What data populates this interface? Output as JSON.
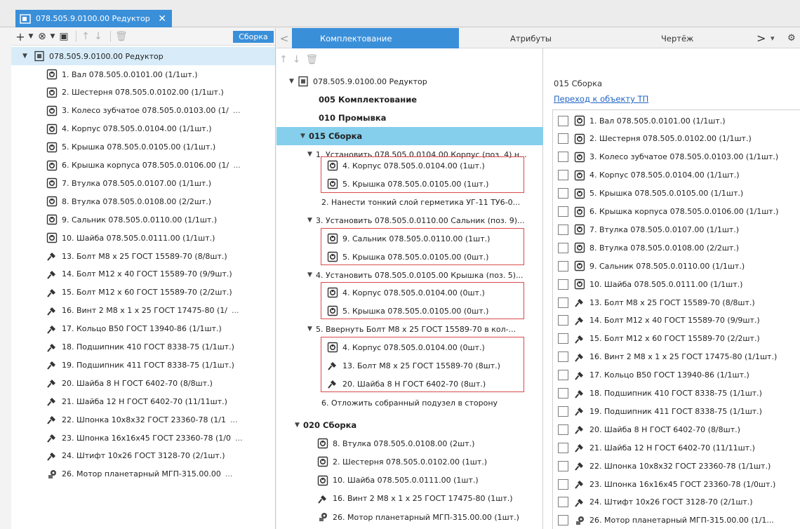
{
  "document_tab": {
    "title": "078.505.9.0100.00 Редуктор",
    "close": "✕"
  },
  "left_panel": {
    "sborka_label": "Сборка",
    "root": "078.505.9.0100.00 Редуктор",
    "items": [
      {
        "label": "1. Вал 078.505.0.0101.00 (1/1шт.)",
        "icon": "part-icon",
        "more": ""
      },
      {
        "label": "2. Шестерня 078.505.0.0102.00 (1/1шт.)",
        "icon": "part-icon",
        "more": ""
      },
      {
        "label": "3. Колесо зубчатое 078.505.0.0103.00 (1/",
        "icon": "part-icon",
        "more": "..."
      },
      {
        "label": "4. Корпус 078.505.0.0104.00 (1/1шт.)",
        "icon": "part-icon",
        "more": ""
      },
      {
        "label": "5. Крышка 078.505.0.0105.00 (1/1шт.)",
        "icon": "part-icon",
        "more": ""
      },
      {
        "label": "6. Крышка корпуса 078.505.0.0106.00 (1/",
        "icon": "part-icon",
        "more": "..."
      },
      {
        "label": "7. Втулка 078.505.0.0107.00 (1/1шт.)",
        "icon": "part-icon",
        "more": ""
      },
      {
        "label": "8. Втулка 078.505.0.0108.00 (2/2шт.)",
        "icon": "part-icon",
        "more": ""
      },
      {
        "label": "9. Сальник 078.505.0.0110.00 (1/1шт.)",
        "icon": "part-icon",
        "more": ""
      },
      {
        "label": "10. Шайба 078.505.0.0111.00 (1/1шт.)",
        "icon": "part-icon",
        "more": ""
      },
      {
        "label": "13. Болт М8 х 25 ГОСТ 15589-70 (8/8шт.)",
        "icon": "bolt-icon",
        "more": ""
      },
      {
        "label": "14. Болт М12 х 40 ГОСТ 15589-70 (9/9шт.)",
        "icon": "bolt-icon",
        "more": ""
      },
      {
        "label": "15. Болт М12 х 60 ГОСТ 15589-70 (2/2шт.)",
        "icon": "bolt-icon",
        "more": ""
      },
      {
        "label": "16. Винт 2 М8 х 1 х 25 ГОСТ 17475-80 (1/",
        "icon": "bolt-icon",
        "more": "..."
      },
      {
        "label": "17. Кольцо В50 ГОСТ 13940-86 (1/1шт.)",
        "icon": "bolt-icon",
        "more": ""
      },
      {
        "label": "18. Подшипник 410 ГОСТ 8338-75 (1/1шт.)",
        "icon": "bolt-icon",
        "more": ""
      },
      {
        "label": "19. Подшипник 411 ГОСТ 8338-75 (1/1шт.)",
        "icon": "bolt-icon",
        "more": ""
      },
      {
        "label": "20. Шайба 8 Н ГОСТ 6402-70 (8/8шт.)",
        "icon": "bolt-icon",
        "more": ""
      },
      {
        "label": "21. Шайба 12 Н ГОСТ 6402-70 (11/11шт.)",
        "icon": "bolt-icon",
        "more": ""
      },
      {
        "label": "22. Шпонка 10х8х32 ГОСТ 23360-78 (1/1",
        "icon": "bolt-icon",
        "more": "..."
      },
      {
        "label": "23. Шпонка 16х16х45 ГОСТ 23360-78 (1/0",
        "icon": "bolt-icon",
        "more": "..."
      },
      {
        "label": "24. Штифт 10х26 ГОСТ 3128-70 (2/1шт.)",
        "icon": "bolt-icon",
        "more": ""
      },
      {
        "label": "26. Мотор планетарный МГП-315.00.00",
        "icon": "motor-icon",
        "more": "..."
      }
    ]
  },
  "tabs": {
    "active": "Комплектование",
    "attributes": "Атрибуты",
    "drawing": "Чертёж",
    "next": ">",
    "menu": "▾",
    "gear": "⚙"
  },
  "middle_tree": {
    "root": "078.505.9.0100.00 Редуктор",
    "op005": "005 Комплектование",
    "op010": "010 Промывка",
    "op015": "015 Сборка",
    "step1": "1. Установить 078.505.0.0104.00 Корпус (поз. 4) н...",
    "step1_items": [
      "4. Корпус 078.505.0.0104.00 (1шт.)",
      "5. Крышка 078.505.0.0105.00 (1шт.)"
    ],
    "step2": "2. Нанести тонкий слой герметика УГ-11 ТУ6-0...",
    "step3": "3. Установить 078.505.0.0110.00 Сальник (поз. 9)...",
    "step3_items": [
      "9. Сальник 078.505.0.0110.00 (1шт.)",
      "5. Крышка 078.505.0.0105.00 (0шт.)"
    ],
    "step4": "4. Установить 078.505.0.0105.00 Крышка (поз. 5)...",
    "step4_items": [
      "4. Корпус 078.505.0.0104.00 (0шт.)",
      "5. Крышка 078.505.0.0105.00 (0шт.)"
    ],
    "step5": "5. Ввернуть  Болт М8 х 25 ГОСТ 15589-70 в кол-...",
    "step5_items": [
      "4. Корпус 078.505.0.0104.00 (0шт.)",
      "13. Болт М8 х 25 ГОСТ 15589-70 (8шт.)",
      "20. Шайба 8 Н ГОСТ 6402-70 (8шт.)"
    ],
    "step6": "6. Отложить собранный подузел в сторону",
    "op020": "020 Сборка",
    "op020_items": [
      "8. Втулка 078.505.0.0108.00 (2шт.)",
      "2. Шестерня 078.505.0.0102.00 (1шт.)",
      "10. Шайба 078.505.0.0111.00 (1шт.)",
      "16. Винт 2 М8 х 1 х 25 ГОСТ 17475-80 (1шт.)",
      "26. Мотор планетарный МГП-315.00.00 (1шт.)"
    ]
  },
  "details": {
    "title": "015 Сборка",
    "link": "Переход к объекту ТП",
    "items": [
      "1. Вал 078.505.0.0101.00 (1/1шт.)",
      "2. Шестерня 078.505.0.0102.00 (1/1шт.)",
      "3. Колесо зубчатое 078.505.0.0103.00 (1/1шт.)",
      "4. Корпус 078.505.0.0104.00 (1/1шт.)",
      "5. Крышка 078.505.0.0105.00 (1/1шт.)",
      "6. Крышка корпуса 078.505.0.0106.00 (1/1шт.)",
      "7. Втулка 078.505.0.0107.00 (1/1шт.)",
      "8. Втулка 078.505.0.0108.00 (2/2шт.)",
      "9. Сальник 078.505.0.0110.00 (1/1шт.)",
      "10. Шайба 078.505.0.0111.00 (1/1шт.)",
      "13. Болт М8 х 25 ГОСТ 15589-70 (8/8шт.)",
      "14. Болт М12 х 40 ГОСТ 15589-70 (9/9шт.)",
      "15. Болт М12 х 60 ГОСТ 15589-70 (2/2шт.)",
      "16. Винт 2 М8 х 1 х 25 ГОСТ 17475-80 (1/1шт.)",
      "17. Кольцо В50 ГОСТ 13940-86 (1/1шт.)",
      "18. Подшипник 410 ГОСТ 8338-75 (1/1шт.)",
      "19. Подшипник 411 ГОСТ 8338-75 (1/1шт.)",
      "20. Шайба 8 Н ГОСТ 6402-70 (8/8шт.)",
      "21. Шайба 12 Н ГОСТ 6402-70 (11/11шт.)",
      "22. Шпонка 10х8х32 ГОСТ 23360-78 (1/1шт.)",
      "23. Шпонка 16х16х45 ГОСТ 23360-78 (1/0шт.)",
      "24. Штифт 10х26 ГОСТ 3128-70 (2/1шт.)",
      "26. Мотор планетарный МГП-315.00.00 (1/1..."
    ],
    "item_icons": [
      "part-icon",
      "part-icon",
      "part-icon",
      "part-icon",
      "part-icon",
      "part-icon",
      "part-icon",
      "part-icon",
      "part-icon",
      "part-icon",
      "bolt-icon",
      "bolt-icon",
      "bolt-icon",
      "bolt-icon",
      "bolt-icon",
      "bolt-icon",
      "bolt-icon",
      "bolt-icon",
      "bolt-icon",
      "bolt-icon",
      "bolt-icon",
      "bolt-icon",
      "motor-icon"
    ]
  },
  "colors": {
    "accent": "#3a8fd9",
    "selected_row": "#85cfec",
    "root_row": "#d7ecf8",
    "red_box": "#d94a4a",
    "link": "#1f64c5"
  }
}
